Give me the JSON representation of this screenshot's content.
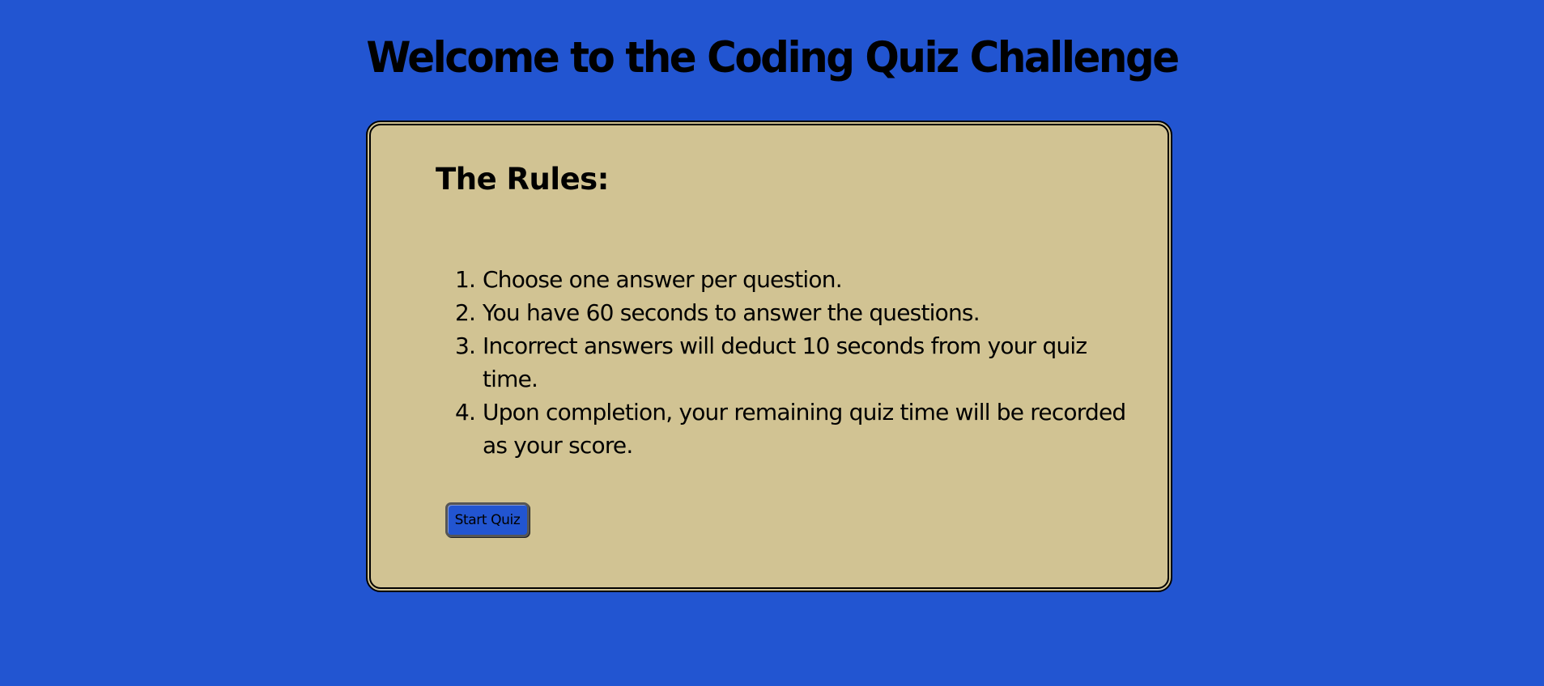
{
  "header": {
    "title": "Welcome to the Coding Quiz Challenge"
  },
  "colors": {
    "background": "#2255d1",
    "card": "#d1c393",
    "text": "#000000"
  },
  "rules": {
    "heading": "The Rules:",
    "items": [
      {
        "number": "1.",
        "text": "Choose one answer per question."
      },
      {
        "number": "2.",
        "text": "You have 60 seconds to answer the questions."
      },
      {
        "number": "3.",
        "text": "Incorrect answers will deduct 10 seconds from your quiz time."
      },
      {
        "number": "4.",
        "text": "Upon completion, your remaining quiz time will be recorded as your score."
      }
    ]
  },
  "actions": {
    "start_label": "Start Quiz"
  }
}
